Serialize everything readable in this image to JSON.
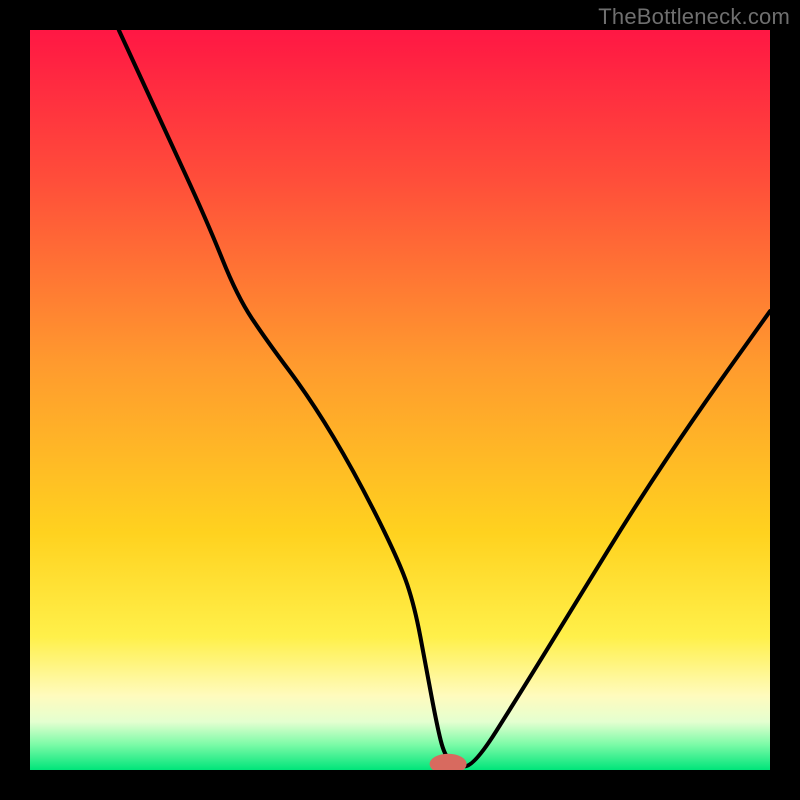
{
  "watermark": "TheBottleneck.com",
  "chart_data": {
    "type": "line",
    "title": "",
    "xlabel": "",
    "ylabel": "",
    "xlim": [
      0,
      100
    ],
    "ylim": [
      0,
      100
    ],
    "background": {
      "kind": "vertical-gradient",
      "stops": [
        {
          "pos": 0.0,
          "color": "#ff1744"
        },
        {
          "pos": 0.2,
          "color": "#ff4d3a"
        },
        {
          "pos": 0.45,
          "color": "#ff9a2e"
        },
        {
          "pos": 0.68,
          "color": "#ffd21f"
        },
        {
          "pos": 0.82,
          "color": "#fff04a"
        },
        {
          "pos": 0.9,
          "color": "#fffbbe"
        },
        {
          "pos": 0.935,
          "color": "#e4ffd0"
        },
        {
          "pos": 0.965,
          "color": "#7efba8"
        },
        {
          "pos": 1.0,
          "color": "#00e57a"
        }
      ]
    },
    "series": [
      {
        "name": "bottleneck-curve",
        "x": [
          12,
          18,
          24,
          28,
          32,
          38,
          44,
          50,
          52,
          53.5,
          55,
          56,
          57.5,
          60,
          66,
          74,
          82,
          90,
          100
        ],
        "y": [
          100,
          87,
          74,
          64,
          58,
          50,
          40,
          28,
          22,
          14,
          6,
          2,
          0.5,
          0.5,
          10,
          23,
          36,
          48,
          62
        ]
      }
    ],
    "marker": {
      "name": "optimal-point",
      "x": 56.5,
      "y": 0.8,
      "color": "#d86a5f",
      "rx": 2.5,
      "ry": 1.4
    }
  }
}
